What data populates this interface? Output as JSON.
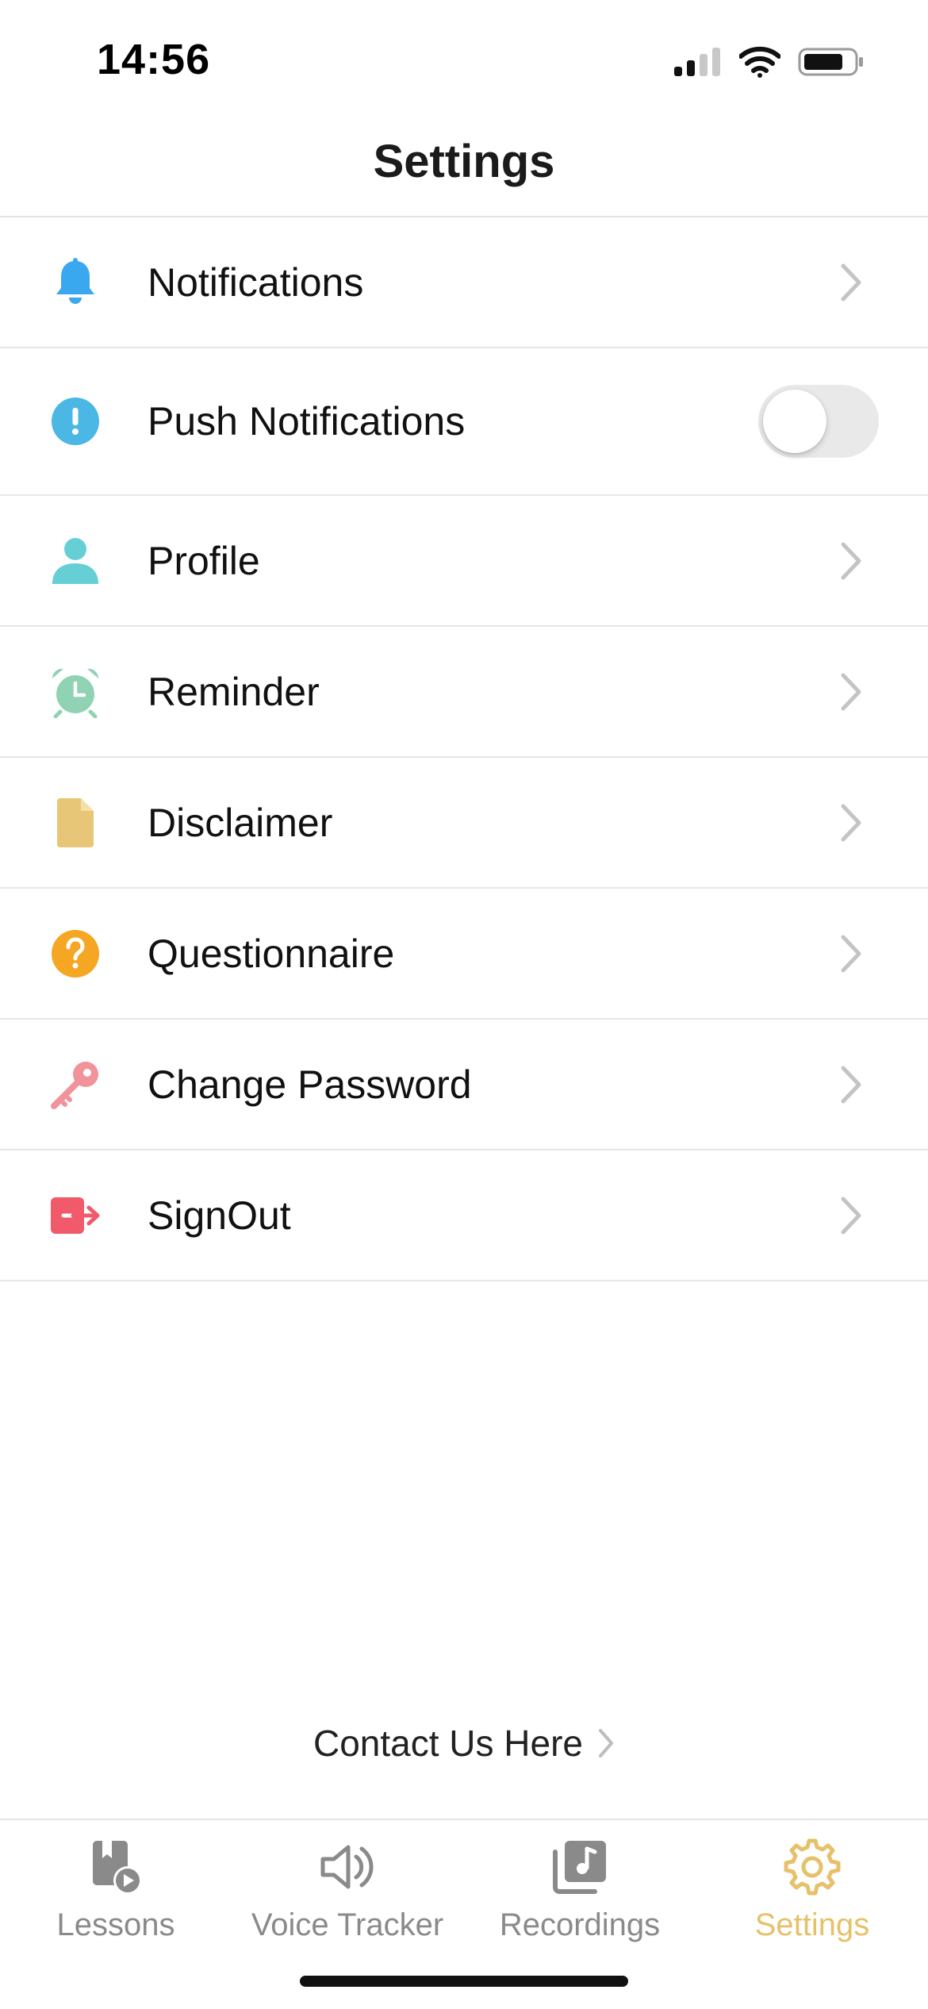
{
  "status_bar": {
    "time": "14:56"
  },
  "header": {
    "title": "Settings"
  },
  "settings": {
    "items": [
      {
        "label": "Notifications",
        "icon": "bell-icon",
        "color": "#3aa8ee"
      },
      {
        "label": "Push Notifications",
        "icon": "exclamation-circle-icon",
        "color": "#4ab7e4",
        "toggle": false
      },
      {
        "label": "Profile",
        "icon": "person-icon",
        "color": "#66cfd6"
      },
      {
        "label": "Reminder",
        "icon": "alarm-clock-icon",
        "color": "#8fd3b4"
      },
      {
        "label": "Disclaimer",
        "icon": "document-icon",
        "color": "#e7c777"
      },
      {
        "label": "Questionnaire",
        "icon": "question-circle-icon",
        "color": "#f5a623"
      },
      {
        "label": "Change Password",
        "icon": "key-icon",
        "color": "#f2939b"
      },
      {
        "label": "SignOut",
        "icon": "sign-out-icon",
        "color": "#f05a6a"
      }
    ]
  },
  "contact": {
    "label": "Contact Us Here"
  },
  "tab_bar": {
    "tabs": [
      {
        "label": "Lessons",
        "icon": "lessons-icon",
        "active": false
      },
      {
        "label": "Voice Tracker",
        "icon": "speaker-icon",
        "active": false
      },
      {
        "label": "Recordings",
        "icon": "music-library-icon",
        "active": false
      },
      {
        "label": "Settings",
        "icon": "gear-icon",
        "active": true
      }
    ],
    "active_color": "#e6c16a",
    "inactive_color": "#8a8a8a"
  }
}
